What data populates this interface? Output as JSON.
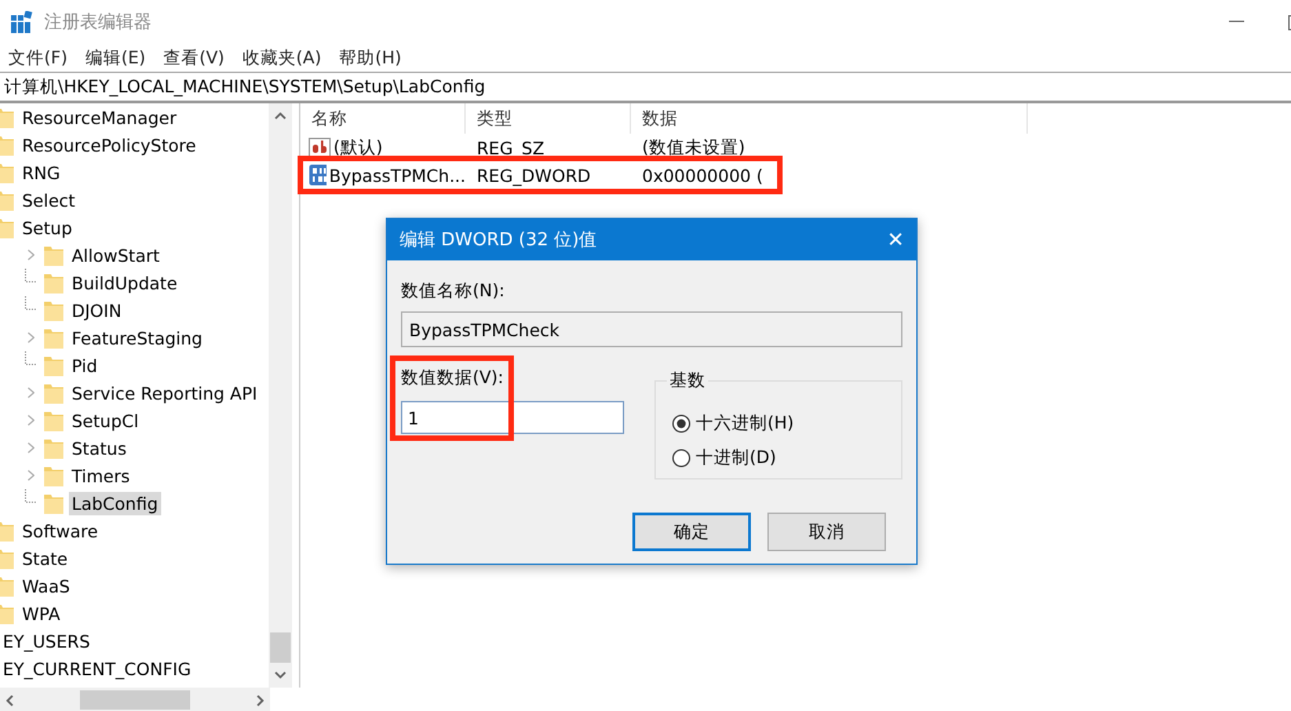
{
  "window": {
    "title": "注册表编辑器"
  },
  "menu": [
    "文件(F)",
    "编辑(E)",
    "查看(V)",
    "收藏夹(A)",
    "帮助(H)"
  ],
  "address": "计算机\\HKEY_LOCAL_MACHINE\\SYSTEM\\Setup\\LabConfig",
  "tree": {
    "items": [
      {
        "kind": "folder",
        "label": "ResourceManager",
        "selected": false
      },
      {
        "kind": "folder",
        "label": "ResourcePolicyStore",
        "selected": false
      },
      {
        "kind": "folder",
        "label": "RNG",
        "selected": false
      },
      {
        "kind": "folder",
        "label": "Select",
        "selected": false
      },
      {
        "kind": "folder",
        "label": "Setup",
        "selected": false,
        "children": [
          {
            "kind": "folder",
            "label": "AllowStart",
            "selected": false,
            "expandable": true
          },
          {
            "kind": "folder",
            "label": "BuildUpdate",
            "selected": false,
            "expandable": false
          },
          {
            "kind": "folder",
            "label": "DJOIN",
            "selected": false,
            "expandable": false
          },
          {
            "kind": "folder",
            "label": "FeatureStaging",
            "selected": false,
            "expandable": true
          },
          {
            "kind": "folder",
            "label": "Pid",
            "selected": false,
            "expandable": false
          },
          {
            "kind": "folder",
            "label": "Service Reporting API",
            "selected": false,
            "expandable": true
          },
          {
            "kind": "folder",
            "label": "SetupCl",
            "selected": false,
            "expandable": true
          },
          {
            "kind": "folder",
            "label": "Status",
            "selected": false,
            "expandable": true
          },
          {
            "kind": "folder",
            "label": "Timers",
            "selected": false,
            "expandable": true
          },
          {
            "kind": "folder",
            "label": "LabConfig",
            "selected": true,
            "expandable": false
          }
        ]
      },
      {
        "kind": "folder",
        "label": "Software",
        "selected": false
      },
      {
        "kind": "folder",
        "label": "State",
        "selected": false
      },
      {
        "kind": "folder",
        "label": "WaaS",
        "selected": false
      },
      {
        "kind": "folder",
        "label": "WPA",
        "selected": false
      },
      {
        "kind": "hive",
        "label": "EY_USERS",
        "selected": false
      },
      {
        "kind": "hive",
        "label": "EY_CURRENT_CONFIG",
        "selected": false
      }
    ]
  },
  "values": {
    "columns": [
      "名称",
      "类型",
      "数据"
    ],
    "rows": [
      {
        "kind": "string",
        "name": "(默认)",
        "type": "REG_SZ",
        "data": "(数值未设置)",
        "highlighted": false
      },
      {
        "kind": "binary",
        "name": "BypassTPMCh...",
        "type": "REG_DWORD",
        "data": "0x00000000 (",
        "highlighted": true
      }
    ]
  },
  "dialog": {
    "title": "编辑 DWORD (32 位)值",
    "close": "✕",
    "name_label": "数值名称(N):",
    "name_value": "BypassTPMCheck",
    "data_label": "数值数据(V):",
    "data_value": "1",
    "data_highlighted": true,
    "base_label": "基数",
    "bases": [
      {
        "label": "十六进制(H)",
        "selected": true
      },
      {
        "label": "十进制(D)",
        "selected": false
      }
    ],
    "buttons": [
      {
        "label": "确定",
        "default": true
      },
      {
        "label": "取消",
        "default": false
      }
    ]
  }
}
